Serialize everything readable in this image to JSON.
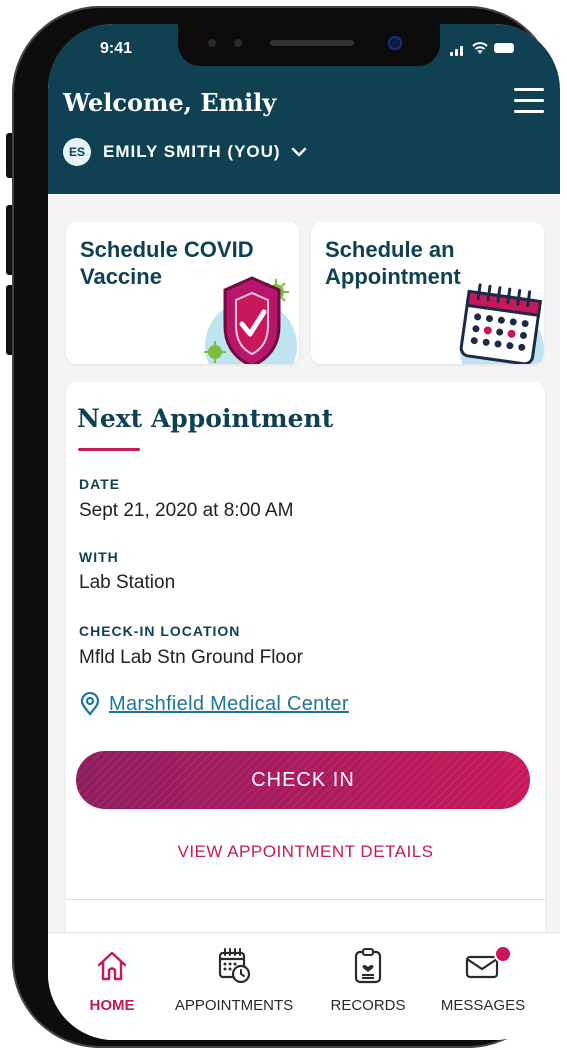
{
  "status_bar": {
    "time": "9:41"
  },
  "header": {
    "welcome": "Welcome, Emily",
    "profile": {
      "initials": "ES",
      "name": "EMILY SMITH (YOU)"
    }
  },
  "tiles": [
    {
      "title": "Schedule COVID Vaccine",
      "icon": "shield-check-icon"
    },
    {
      "title": "Schedule an Appointment",
      "icon": "calendar-icon"
    }
  ],
  "next_appointment": {
    "title": "Next Appointment",
    "date_label": "DATE",
    "date_value": "Sept 21, 2020 at 8:00 AM",
    "with_label": "WITH",
    "with_value": "Lab Station",
    "checkin_label": "CHECK-IN LOCATION",
    "checkin_value": "Mfld Lab Stn Ground Floor",
    "location_link": "Marshfield Medical Center",
    "checkin_button": "CHECK IN",
    "view_details": "VIEW APPOINTMENT DETAILS"
  },
  "tab_bar": {
    "tabs": [
      {
        "label": "HOME",
        "icon": "home-icon",
        "active": true
      },
      {
        "label": "APPOINTMENTS",
        "icon": "calendar-clock-icon",
        "active": false
      },
      {
        "label": "RECORDS",
        "icon": "clipboard-heart-icon",
        "active": false
      },
      {
        "label": "MESSAGES",
        "icon": "envelope-icon",
        "active": false,
        "has_notification": true
      }
    ]
  },
  "colors": {
    "header_bg": "#0f4153",
    "accent": "#c8175b",
    "link": "#1f7694"
  }
}
